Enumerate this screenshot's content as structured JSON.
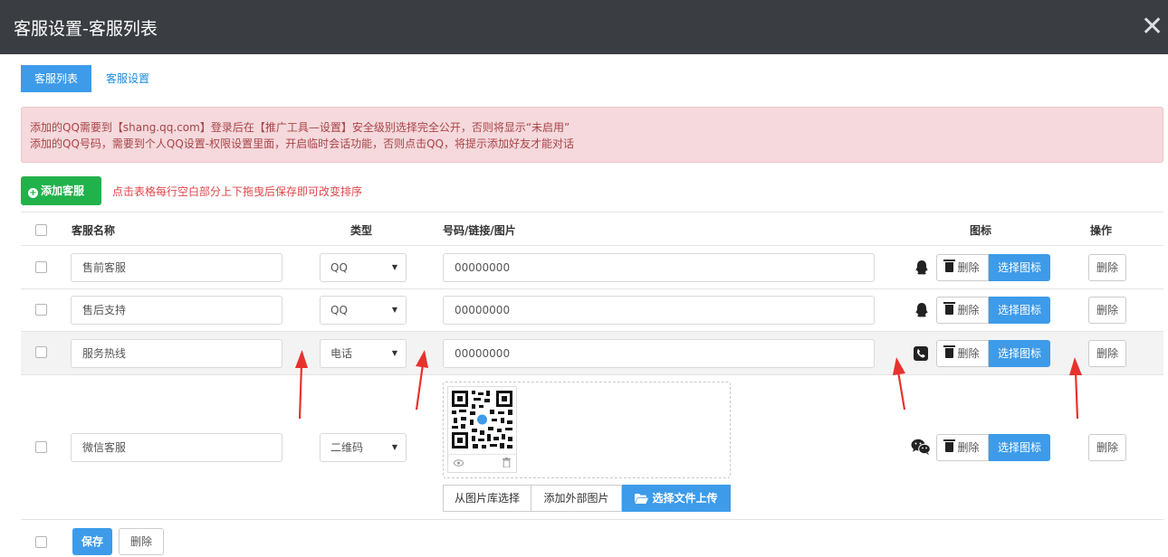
{
  "window": {
    "title": "客服设置-客服列表",
    "close": "✕"
  },
  "tabs": [
    {
      "label": "客服列表"
    },
    {
      "label": "客服设置"
    }
  ],
  "alert": {
    "line1": "添加的QQ需要到【shang.qq.com】登录后在【推广工具—设置】安全级别选择完全公开，否则将显示“未启用”",
    "line2": "添加的QQ号码，需要到个人QQ设置-权限设置里面，开启临时会话功能，否则点击QQ，将提示添加好友才能对话"
  },
  "toolbar": {
    "add_label": "添加客服",
    "hint": "点击表格每行空白部分上下拖曳后保存即可改变排序"
  },
  "table": {
    "headers": {
      "name": "客服名称",
      "type": "类型",
      "value": "号码/链接/图片",
      "icon": "图标",
      "op": "操作"
    },
    "rows": [
      {
        "name": "售前客服",
        "type": "QQ",
        "value": "00000000",
        "icon": "qq-penguin-icon"
      },
      {
        "name": "售后支持",
        "type": "QQ",
        "value": "00000000",
        "icon": "qq-penguin-icon"
      },
      {
        "name": "服务热线",
        "type": "电话",
        "value": "00000000",
        "icon": "phone-icon"
      },
      {
        "name": "微信客服",
        "type": "二维码",
        "value": "",
        "icon": "wechat-icon"
      }
    ],
    "icon_delete_label": "删除",
    "choose_icon_label": "选择图标",
    "row_delete_label": "删除"
  },
  "image_picker": {
    "from_library": "从图片库选择",
    "add_external": "添加外部图片",
    "upload": "选择文件上传"
  },
  "footer": {
    "save_label": "保存",
    "delete_label": "删除"
  },
  "colors": {
    "primary": "#3d9be9",
    "success": "#21b24b",
    "danger_text": "#e0464a",
    "alert_bg": "#f5d9dc",
    "titlebar": "#3a3d42",
    "arrow": "#e8322d"
  }
}
